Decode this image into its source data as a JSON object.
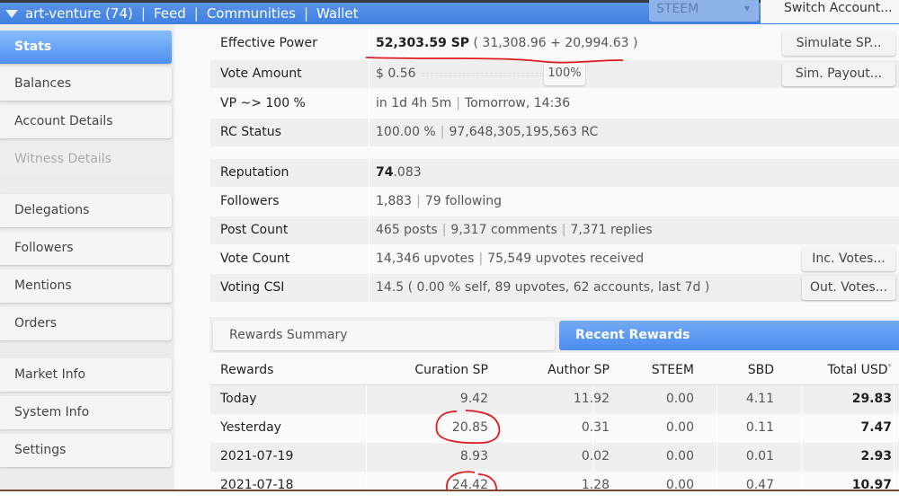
{
  "topbar": {
    "account": "art-venture (74)",
    "nav": [
      "Feed",
      "Communities",
      "Wallet"
    ],
    "chain_select": "STEEM",
    "switch_account": "Switch Account..."
  },
  "sidebar": {
    "items": [
      {
        "label": "Stats",
        "state": "active"
      },
      {
        "label": "Balances",
        "state": "normal"
      },
      {
        "label": "Account Details",
        "state": "normal"
      },
      {
        "label": "Witness Details",
        "state": "disabled"
      },
      {
        "label": "Delegations",
        "state": "normal"
      },
      {
        "label": "Followers",
        "state": "normal"
      },
      {
        "label": "Mentions",
        "state": "normal"
      },
      {
        "label": "Orders",
        "state": "normal"
      },
      {
        "label": "Market Info",
        "state": "normal"
      },
      {
        "label": "System Info",
        "state": "normal"
      },
      {
        "label": "Settings",
        "state": "normal"
      }
    ]
  },
  "stats": {
    "effective_power": {
      "label": "Effective Power",
      "value_bold": "52,303.59 SP",
      "value_rest": " ( 31,308.96 + 20,994.63 )",
      "button": "Simulate SP..."
    },
    "vote_amount": {
      "label": "Vote Amount",
      "value": "$ 0.56",
      "slider_percent": "100%",
      "slider_fraction": 1.0,
      "button": "Sim. Payout..."
    },
    "vp": {
      "label": "VP ~> 100 %",
      "value_a": "in 1d 4h 5m",
      "value_b": "Tomorrow, 14:36"
    },
    "rc": {
      "label": "RC Status",
      "value_a": "100.00 %",
      "value_b": "97,648,305,195,563 RC"
    },
    "reputation": {
      "label": "Reputation",
      "value_bold": "74",
      "value_rest": ".083"
    },
    "followers": {
      "label": "Followers",
      "value_a": "1,883",
      "value_b": "79 following"
    },
    "post_count": {
      "label": "Post Count",
      "value_a": "465 posts",
      "value_b": "9,317 comments",
      "value_c": "7,371 replies"
    },
    "vote_count": {
      "label": "Vote Count",
      "value_a": "14,346 upvotes",
      "value_b": "75,549 upvotes received",
      "button": "Inc. Votes..."
    },
    "voting_csi": {
      "label": "Voting CSI",
      "value": "14.5 ( 0.00 % self, 89 upvotes, 62 accounts, last 7d )",
      "button": "Out. Votes..."
    }
  },
  "rewards": {
    "tabs": [
      {
        "label": "Rewards Summary",
        "active": false
      },
      {
        "label": "Recent Rewards",
        "active": true
      }
    ],
    "headers": [
      "Rewards",
      "Curation SP",
      "Author SP",
      "STEEM",
      "SBD",
      "Total USD"
    ],
    "total_footnote_mark": "*",
    "rows": [
      [
        "Today",
        "9.42",
        "11.92",
        "0.00",
        "4.11",
        "29.83"
      ],
      [
        "Yesterday",
        "20.85",
        "0.31",
        "0.00",
        "0.11",
        "7.47"
      ],
      [
        "2021-07-19",
        "8.93",
        "0.02",
        "0.00",
        "0.01",
        "2.93"
      ],
      [
        "2021-07-18",
        "24.42",
        "1.28",
        "0.00",
        "0.47",
        "10.97"
      ]
    ]
  },
  "annotations": {
    "color": "#e0191e",
    "underline_target": "Effective Power value",
    "circled_values": [
      "20.85",
      "24.42"
    ]
  }
}
